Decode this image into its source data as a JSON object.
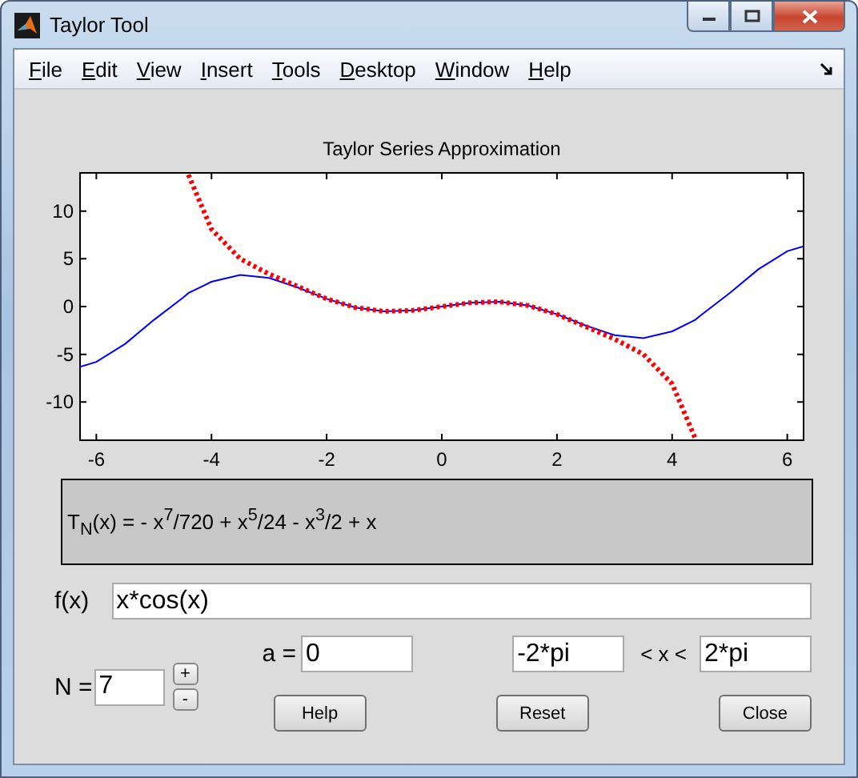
{
  "window": {
    "title": "Taylor Tool"
  },
  "menu": [
    "File",
    "Edit",
    "View",
    "Insert",
    "Tools",
    "Desktop",
    "Window",
    "Help"
  ],
  "plot": {
    "chart_data": {
      "type": "line",
      "title": "Taylor Series Approximation",
      "x": [
        -6.2832,
        -6,
        -5.5,
        -5,
        -4.5,
        -4.4,
        -4,
        -3.5,
        -3,
        -2.5,
        -2,
        -1.5,
        -1,
        -0.5,
        0,
        0.5,
        1,
        1.5,
        2,
        2.5,
        3,
        3.5,
        4,
        4.4,
        4.5,
        5,
        5.5,
        6,
        6.2832
      ],
      "series": [
        {
          "color": "#0000ff",
          "line_style": "solid",
          "values": [
            -6.3,
            -5.8,
            -3.9,
            -1.4,
            0.9,
            1.4,
            2.6,
            3.3,
            3.0,
            2.0,
            0.8,
            -0.1,
            -0.5,
            -0.4,
            0,
            0.4,
            0.5,
            0.1,
            -0.8,
            -2.0,
            -3.0,
            -3.3,
            -2.6,
            -1.4,
            -0.9,
            1.4,
            3.9,
            5.8,
            6.3
          ]
        },
        {
          "color": "#ff0000",
          "line_style": "dotted",
          "values": [
            null,
            null,
            null,
            null,
            null,
            13.8,
            8.1,
            5.0,
            3.4,
            2.1,
            0.8,
            -0.1,
            -0.5,
            -0.4,
            0,
            0.4,
            0.5,
            0.1,
            -0.8,
            -2.1,
            -3.4,
            -5.0,
            -8.1,
            -13.8,
            null,
            null,
            null,
            null,
            null
          ]
        }
      ],
      "xlim": [
        -6.2832,
        6.2832
      ],
      "ylim": [
        -14,
        14
      ],
      "xticks": [
        -6,
        -4,
        -2,
        0,
        2,
        4,
        6
      ],
      "yticks": [
        -10,
        -5,
        0,
        5,
        10
      ]
    }
  },
  "formula": "T$_{N}$(x) =  - x$^{7}$/720 + x$^{5}$/24 - x$^{3}$/2 + x",
  "function": {
    "label": "f(x)",
    "value": "x*cos(x)"
  },
  "order": {
    "label": "N =",
    "value": "7",
    "increment": "+",
    "decrement": "-"
  },
  "expansion_point": {
    "label": "a =",
    "value": "0"
  },
  "range": {
    "lower": "-2*pi",
    "separator": "< x <",
    "upper": "2*pi"
  },
  "buttons": [
    "Help",
    "Reset",
    "Close"
  ]
}
